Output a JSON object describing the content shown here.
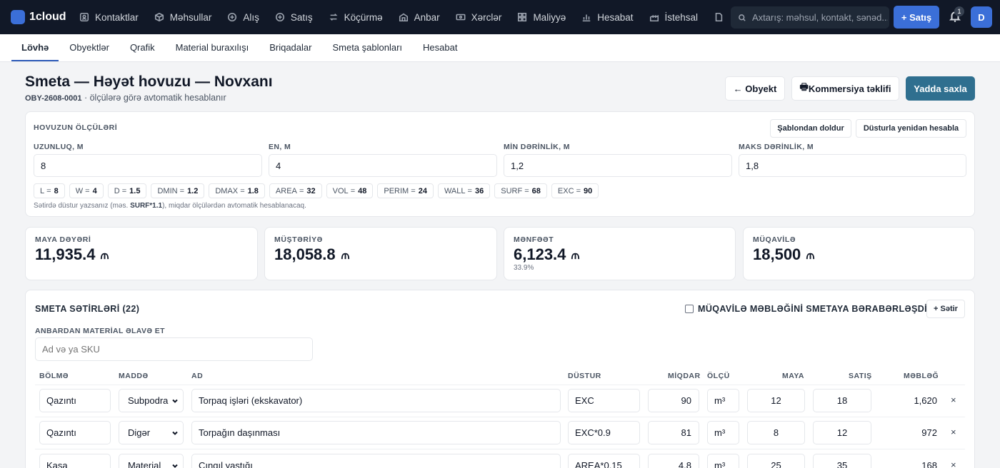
{
  "app": {
    "name": "1cloud"
  },
  "topnav": {
    "items": [
      {
        "label": "Kontaktlar",
        "icon": "contacts-icon"
      },
      {
        "label": "Məhsullar",
        "icon": "box-icon"
      },
      {
        "label": "Alış",
        "icon": "plus-circle-icon"
      },
      {
        "label": "Satış",
        "icon": "plus-circle-icon"
      },
      {
        "label": "Köçürmə",
        "icon": "transfer-icon"
      },
      {
        "label": "Anbar",
        "icon": "warehouse-icon"
      },
      {
        "label": "Xərclər",
        "icon": "cash-icon"
      },
      {
        "label": "Maliyyə",
        "icon": "grid-icon"
      },
      {
        "label": "Hesabat",
        "icon": "bar-chart-icon"
      },
      {
        "label": "İstehsal",
        "icon": "factory-icon"
      }
    ],
    "search_placeholder": "Axtarış: məhsul, kontakt, sənəd...",
    "sale_button": "+ Satış",
    "notification_count": "1",
    "user_initial": "D"
  },
  "subnav": {
    "tabs": [
      "Lövhə",
      "Obyektlər",
      "Qrafik",
      "Material buraxılışı",
      "Briqadalar",
      "Smeta şablonları",
      "Hesabat"
    ],
    "active": "Lövhə"
  },
  "header": {
    "title": "Smeta — Həyət hovuzu — Novxanı",
    "code": "OBY-2608-0001",
    "subtitle": " · ölçülərə görə avtomatik hesablanır",
    "back_button": "← Obyekt",
    "offer_button": "Kommersiya təklifi",
    "save_button": "Yadda saxla"
  },
  "dimensions": {
    "title": "HOVUZUN ÖLÇÜLƏRİ",
    "template_button": "Şablondan doldur",
    "recalc_button": "Düsturla yenidən hesabla",
    "fields": [
      {
        "label": "UZUNLUQ, M",
        "value": "8"
      },
      {
        "label": "EN, M",
        "value": "4"
      },
      {
        "label": "MİN DƏRİNLİK, M",
        "value": "1,2"
      },
      {
        "label": "MAKS DƏRİNLİK, M",
        "value": "1,8"
      }
    ],
    "chips": [
      {
        "k": "L",
        "v": "8"
      },
      {
        "k": "W",
        "v": "4"
      },
      {
        "k": "D",
        "v": "1.5"
      },
      {
        "k": "DMIN",
        "v": "1.2"
      },
      {
        "k": "DMAX",
        "v": "1.8"
      },
      {
        "k": "AREA",
        "v": "32"
      },
      {
        "k": "VOL",
        "v": "48"
      },
      {
        "k": "PERIM",
        "v": "24"
      },
      {
        "k": "WALL",
        "v": "36"
      },
      {
        "k": "SURF",
        "v": "68"
      },
      {
        "k": "EXC",
        "v": "90"
      }
    ],
    "hint_prefix": "Sətirdə düstur yazsanız (məs. ",
    "hint_code": "SURF*1.1",
    "hint_suffix": "), miqdar ölçülərdən avtomatik hesablanacaq."
  },
  "stats": [
    {
      "label": "MAYA DƏYƏRİ",
      "value": "11,935.4",
      "pct": ""
    },
    {
      "label": "MÜŞTƏRİYƏ",
      "value": "18,058.8",
      "pct": ""
    },
    {
      "label": "MƏNFƏƏT",
      "value": "6,123.4",
      "pct": "33.9%"
    },
    {
      "label": "MÜQAVİLƏ",
      "value": "18,500",
      "pct": ""
    }
  ],
  "lines": {
    "title": "SMETA SƏTİRLƏRİ (22)",
    "contract_checkbox_label": "MÜQAVİLƏ MƏBLƏĞİNİ SMETAYA BƏRABƏRLƏŞDİR",
    "add_row_button": "+ Sətir",
    "warehouse_label": "ANBARDAN MATERİAL ƏLAVƏ ET",
    "warehouse_placeholder": "Ad və ya SKU",
    "columns": [
      "BÖLMƏ",
      "MADDƏ",
      "AD",
      "DÜSTUR",
      "MİQDAR",
      "ÖLÇÜ",
      "MAYA",
      "SATIŞ",
      "MƏBLƏĞ"
    ],
    "rows": [
      {
        "section": "Qazıntı",
        "item": "Subpodra",
        "name": "Torpaq işləri (ekskavator)",
        "formula": "EXC",
        "qty": "90",
        "unit": "m³",
        "cost": "12",
        "price": "18",
        "amount": "1,620"
      },
      {
        "section": "Qazıntı",
        "item": "Digər",
        "name": "Torpağın daşınması",
        "formula": "EXC*0.9",
        "qty": "81",
        "unit": "m³",
        "cost": "8",
        "price": "12",
        "amount": "972"
      },
      {
        "section": "Kasa",
        "item": "Material",
        "name": "Çınqıl yastığı",
        "formula": "AREA*0.15",
        "qty": "4.8",
        "unit": "m³",
        "cost": "25",
        "price": "35",
        "amount": "168"
      }
    ],
    "remove_symbol": "×"
  }
}
